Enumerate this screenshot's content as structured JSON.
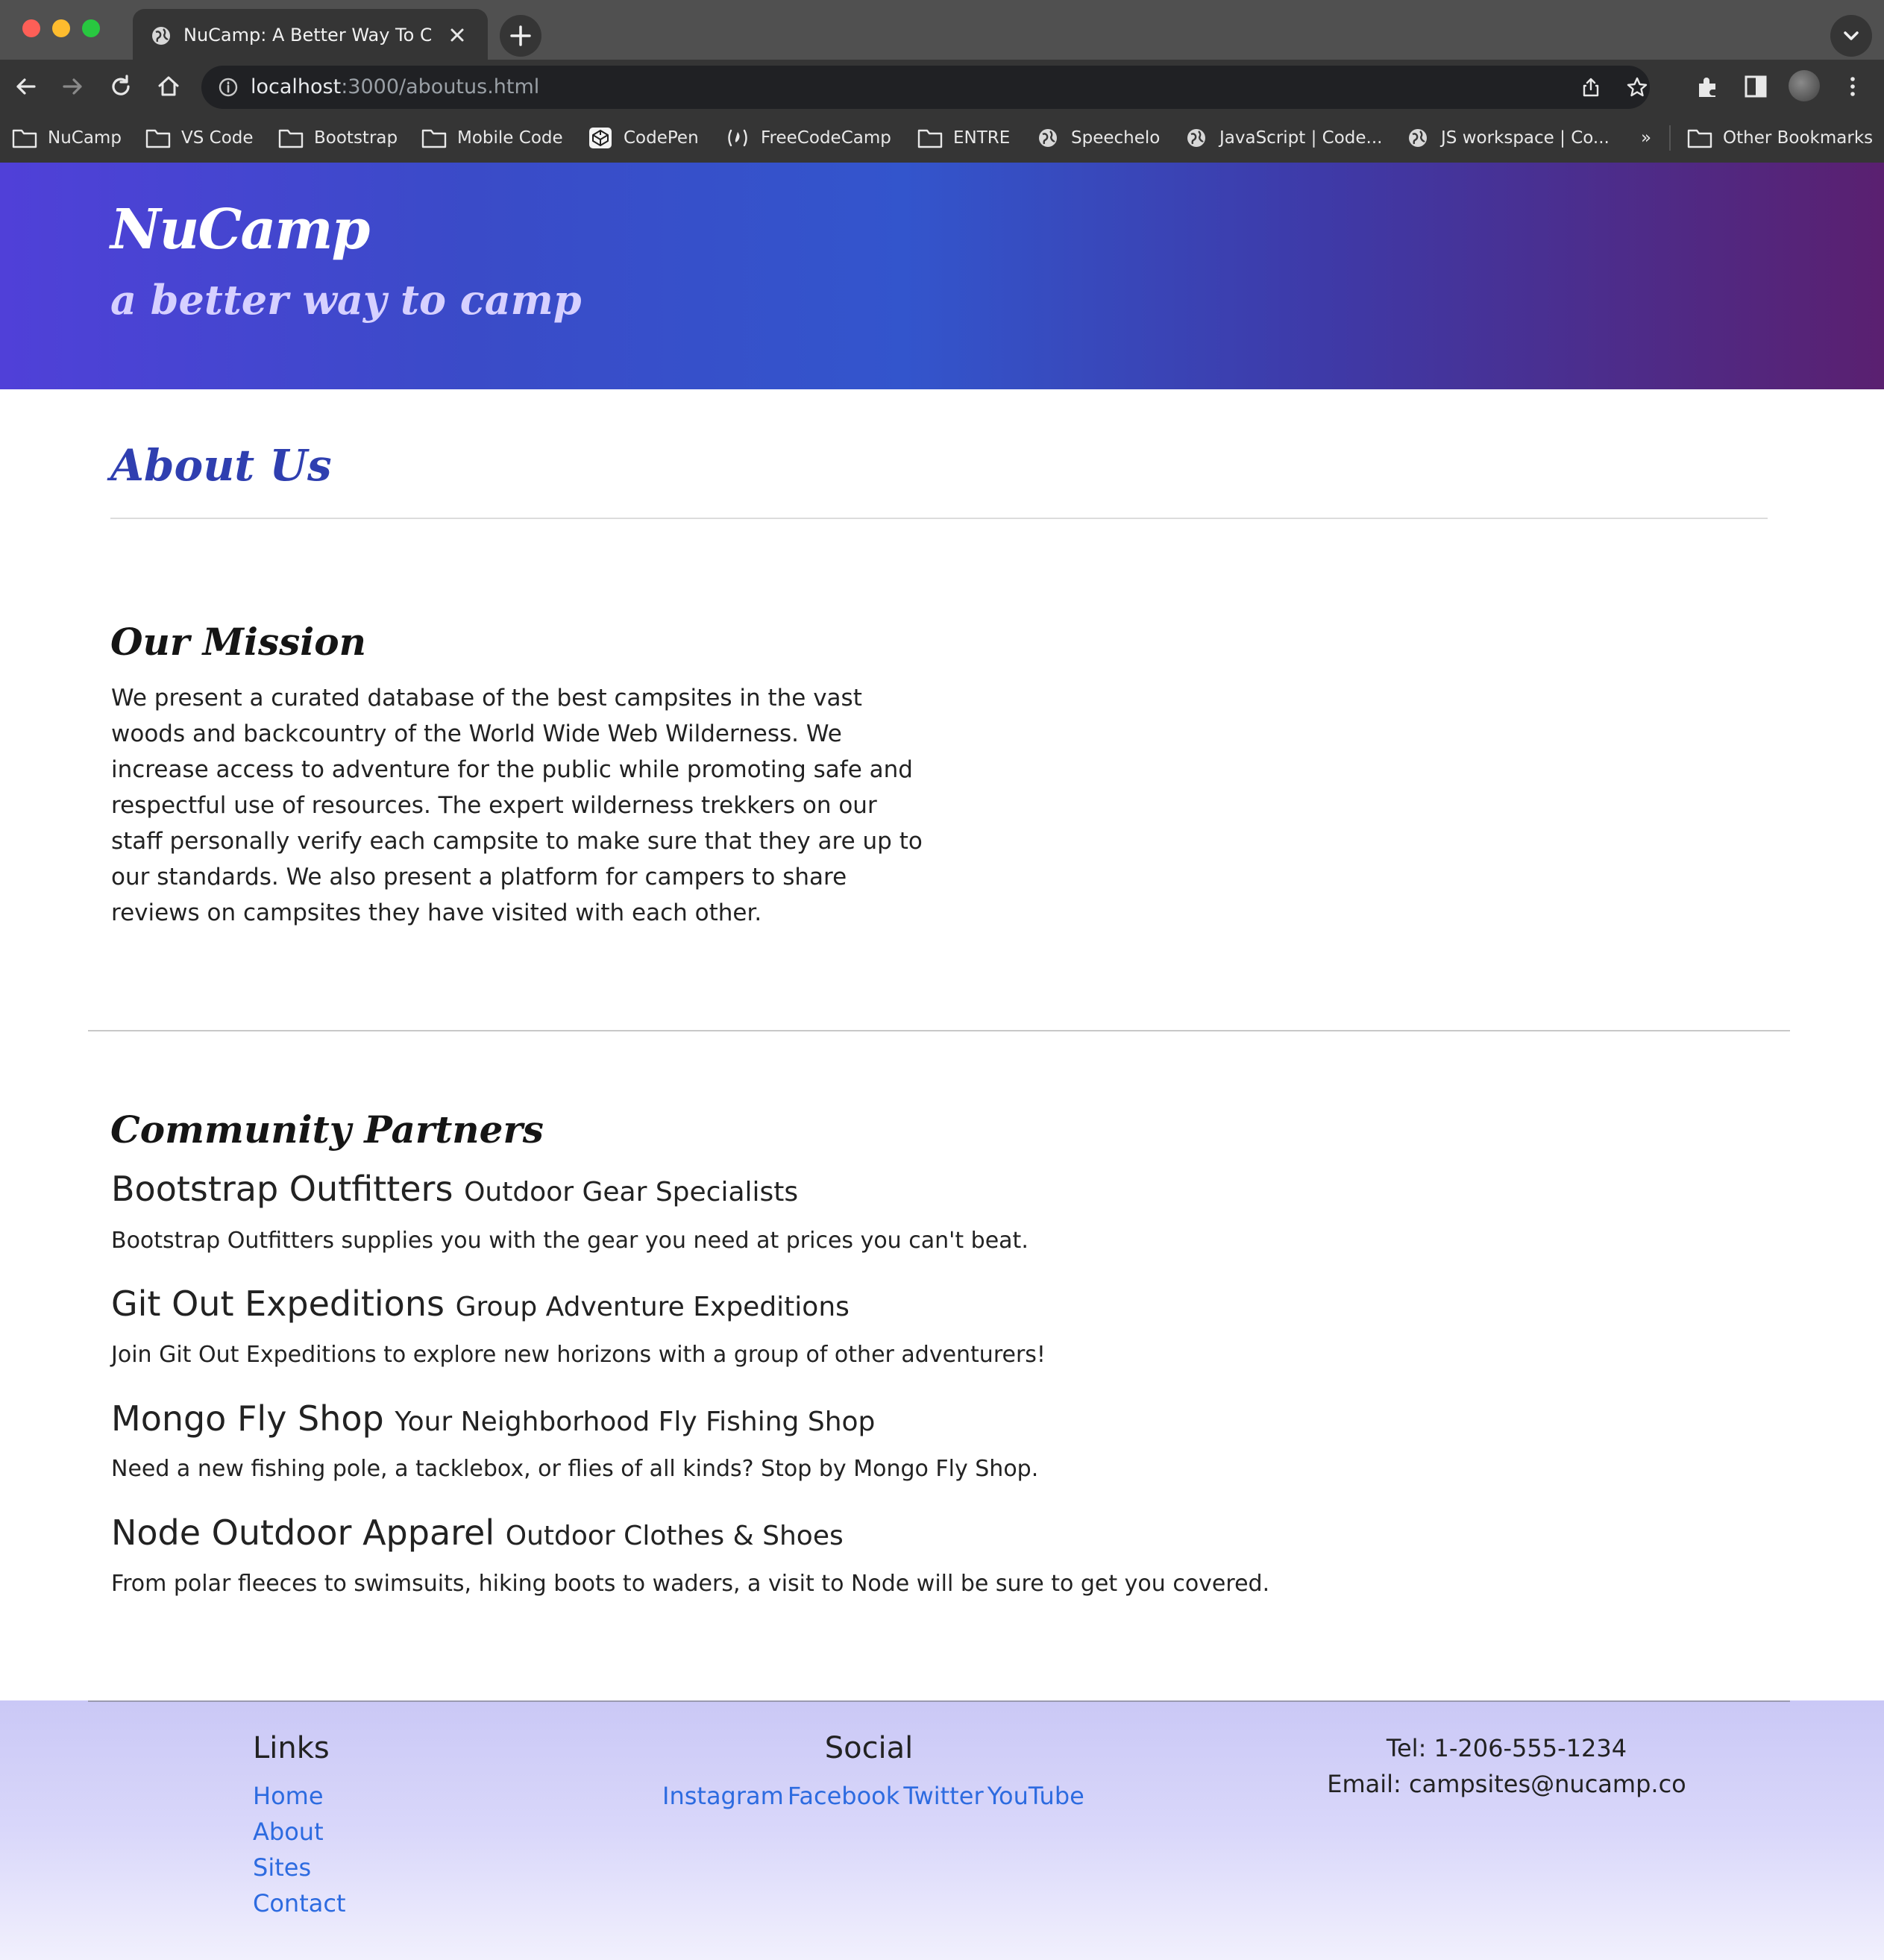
{
  "browser": {
    "tab_title": "NuCamp: A Better Way To Camp",
    "url_host": "localhost",
    "url_path": ":3000/aboutus.html",
    "bookmarks": [
      {
        "label": "NuCamp",
        "icon": "folder-icon"
      },
      {
        "label": "VS Code",
        "icon": "folder-icon"
      },
      {
        "label": "Bootstrap",
        "icon": "folder-icon"
      },
      {
        "label": "Mobile Code",
        "icon": "folder-icon"
      },
      {
        "label": "CodePen",
        "icon": "codepen-icon"
      },
      {
        "label": "FreeCodeCamp",
        "icon": "freecodecamp-icon"
      },
      {
        "label": "ENTRE",
        "icon": "folder-icon"
      },
      {
        "label": "Speechelo",
        "icon": "globe-icon"
      },
      {
        "label": "JavaScript | Code...",
        "icon": "globe-icon"
      },
      {
        "label": "JS workspace | Co...",
        "icon": "globe-icon"
      }
    ],
    "overflow_label": "»",
    "other_bookmarks": "Other Bookmarks"
  },
  "header": {
    "brand": "NuCamp",
    "tagline": "a better way to camp"
  },
  "about": {
    "title": "About Us"
  },
  "mission": {
    "title": "Our Mission",
    "text": "We present a curated database of the best campsites in the vast woods and backcountry of the World Wide Web Wilderness. We increase access to adventure for the public while promoting safe and respectful use of resources. The expert wilderness trekkers on our staff personally verify each campsite to make sure that they are up to our standards. We also present a platform for campers to share reviews on campsites they have visited with each other."
  },
  "partners": {
    "title": "Community Partners",
    "items": [
      {
        "name": "Bootstrap Outfitters",
        "tagline": "Outdoor Gear Specialists",
        "description": "Bootstrap Outfitters supplies you with the gear you need at prices you can't beat."
      },
      {
        "name": "Git Out Expeditions",
        "tagline": "Group Adventure Expeditions",
        "description": "Join Git Out Expeditions to explore new horizons with a group of other adventurers!"
      },
      {
        "name": "Mongo Fly Shop",
        "tagline": "Your Neighborhood Fly Fishing Shop",
        "description": "Need a new fishing pole, a tacklebox, or flies of all kinds? Stop by Mongo Fly Shop."
      },
      {
        "name": "Node Outdoor Apparel",
        "tagline": "Outdoor Clothes & Shoes",
        "description": "From polar fleeces to swimsuits, hiking boots to waders, a visit to Node will be sure to get you covered."
      }
    ]
  },
  "footer": {
    "links_heading": "Links",
    "links": [
      "Home",
      "About",
      "Sites",
      "Contact"
    ],
    "social_heading": "Social",
    "social": [
      "Instagram",
      "Facebook",
      "Twitter",
      "YouTube"
    ],
    "tel": "Tel: 1-206-555-1234",
    "email": "Email: campsites@nucamp.co"
  },
  "colors": {
    "heading_blue": "#2f3fb0",
    "link_blue": "#2d6be0",
    "jumbotron_start": "#5040d8",
    "jumbotron_end": "#5a2070"
  }
}
